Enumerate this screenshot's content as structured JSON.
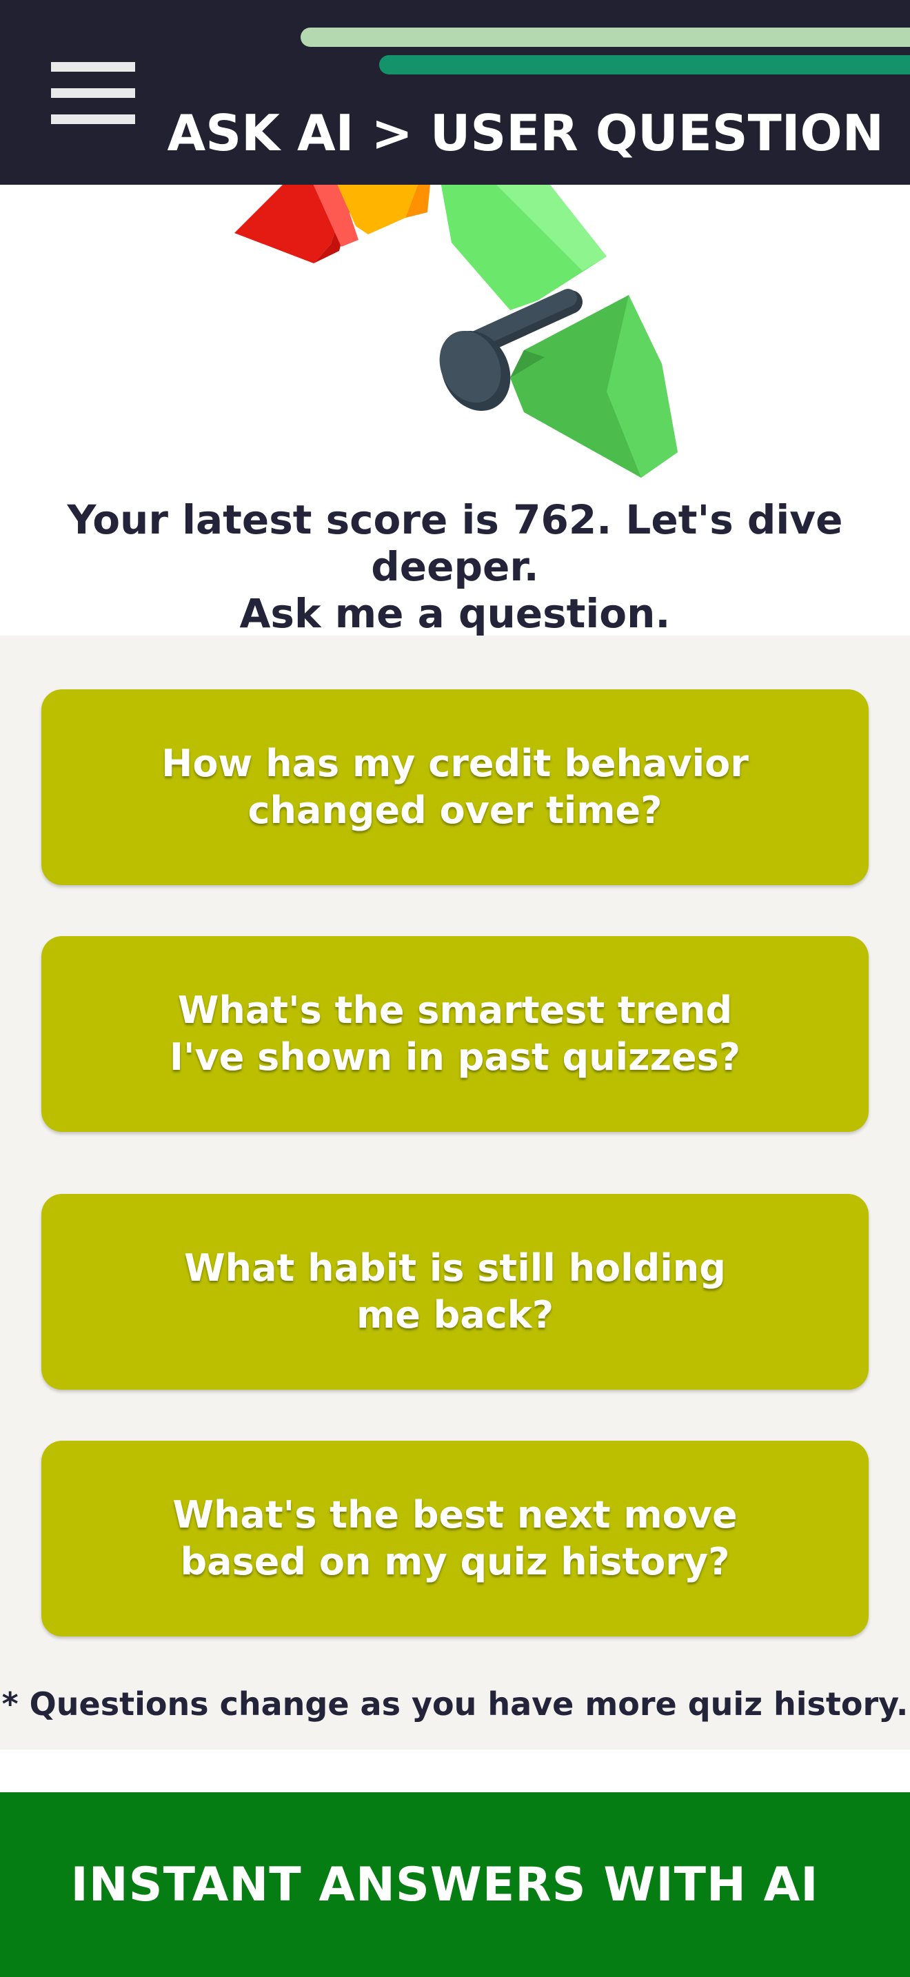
{
  "header": {
    "title": "ASK AI > USER QUESTION",
    "menu_icon": "hamburger-menu-icon",
    "background_color": "#212131",
    "stripe_colors": [
      "#b4d9b0",
      "#14936a"
    ]
  },
  "gauge": {
    "icon": "credit-score-gauge-icon",
    "segment_colors": [
      "#e31b12",
      "#ffb400",
      "#6be86b",
      "#4cc94c"
    ],
    "needle_color": "#3a4a55"
  },
  "intro": {
    "line1": "Your latest score is 762. Let's dive deeper.",
    "line2": "Ask me a question."
  },
  "questions": [
    {
      "label": "How has my credit behavior changed over time?"
    },
    {
      "label": "What's the smartest trend I've shown in past quizzes?"
    },
    {
      "label": "What habit is still holding me back?"
    },
    {
      "label": "What's the best next move based on my quiz history?"
    }
  ],
  "footnote": "* Questions change as you have more quiz history.",
  "cta": {
    "label": "INSTANT ANSWERS WITH AI",
    "background_color": "#067d13"
  },
  "colors": {
    "question_button": "#bbbf00",
    "panel_background": "#f4f3ef",
    "text_dark": "#23233a"
  }
}
